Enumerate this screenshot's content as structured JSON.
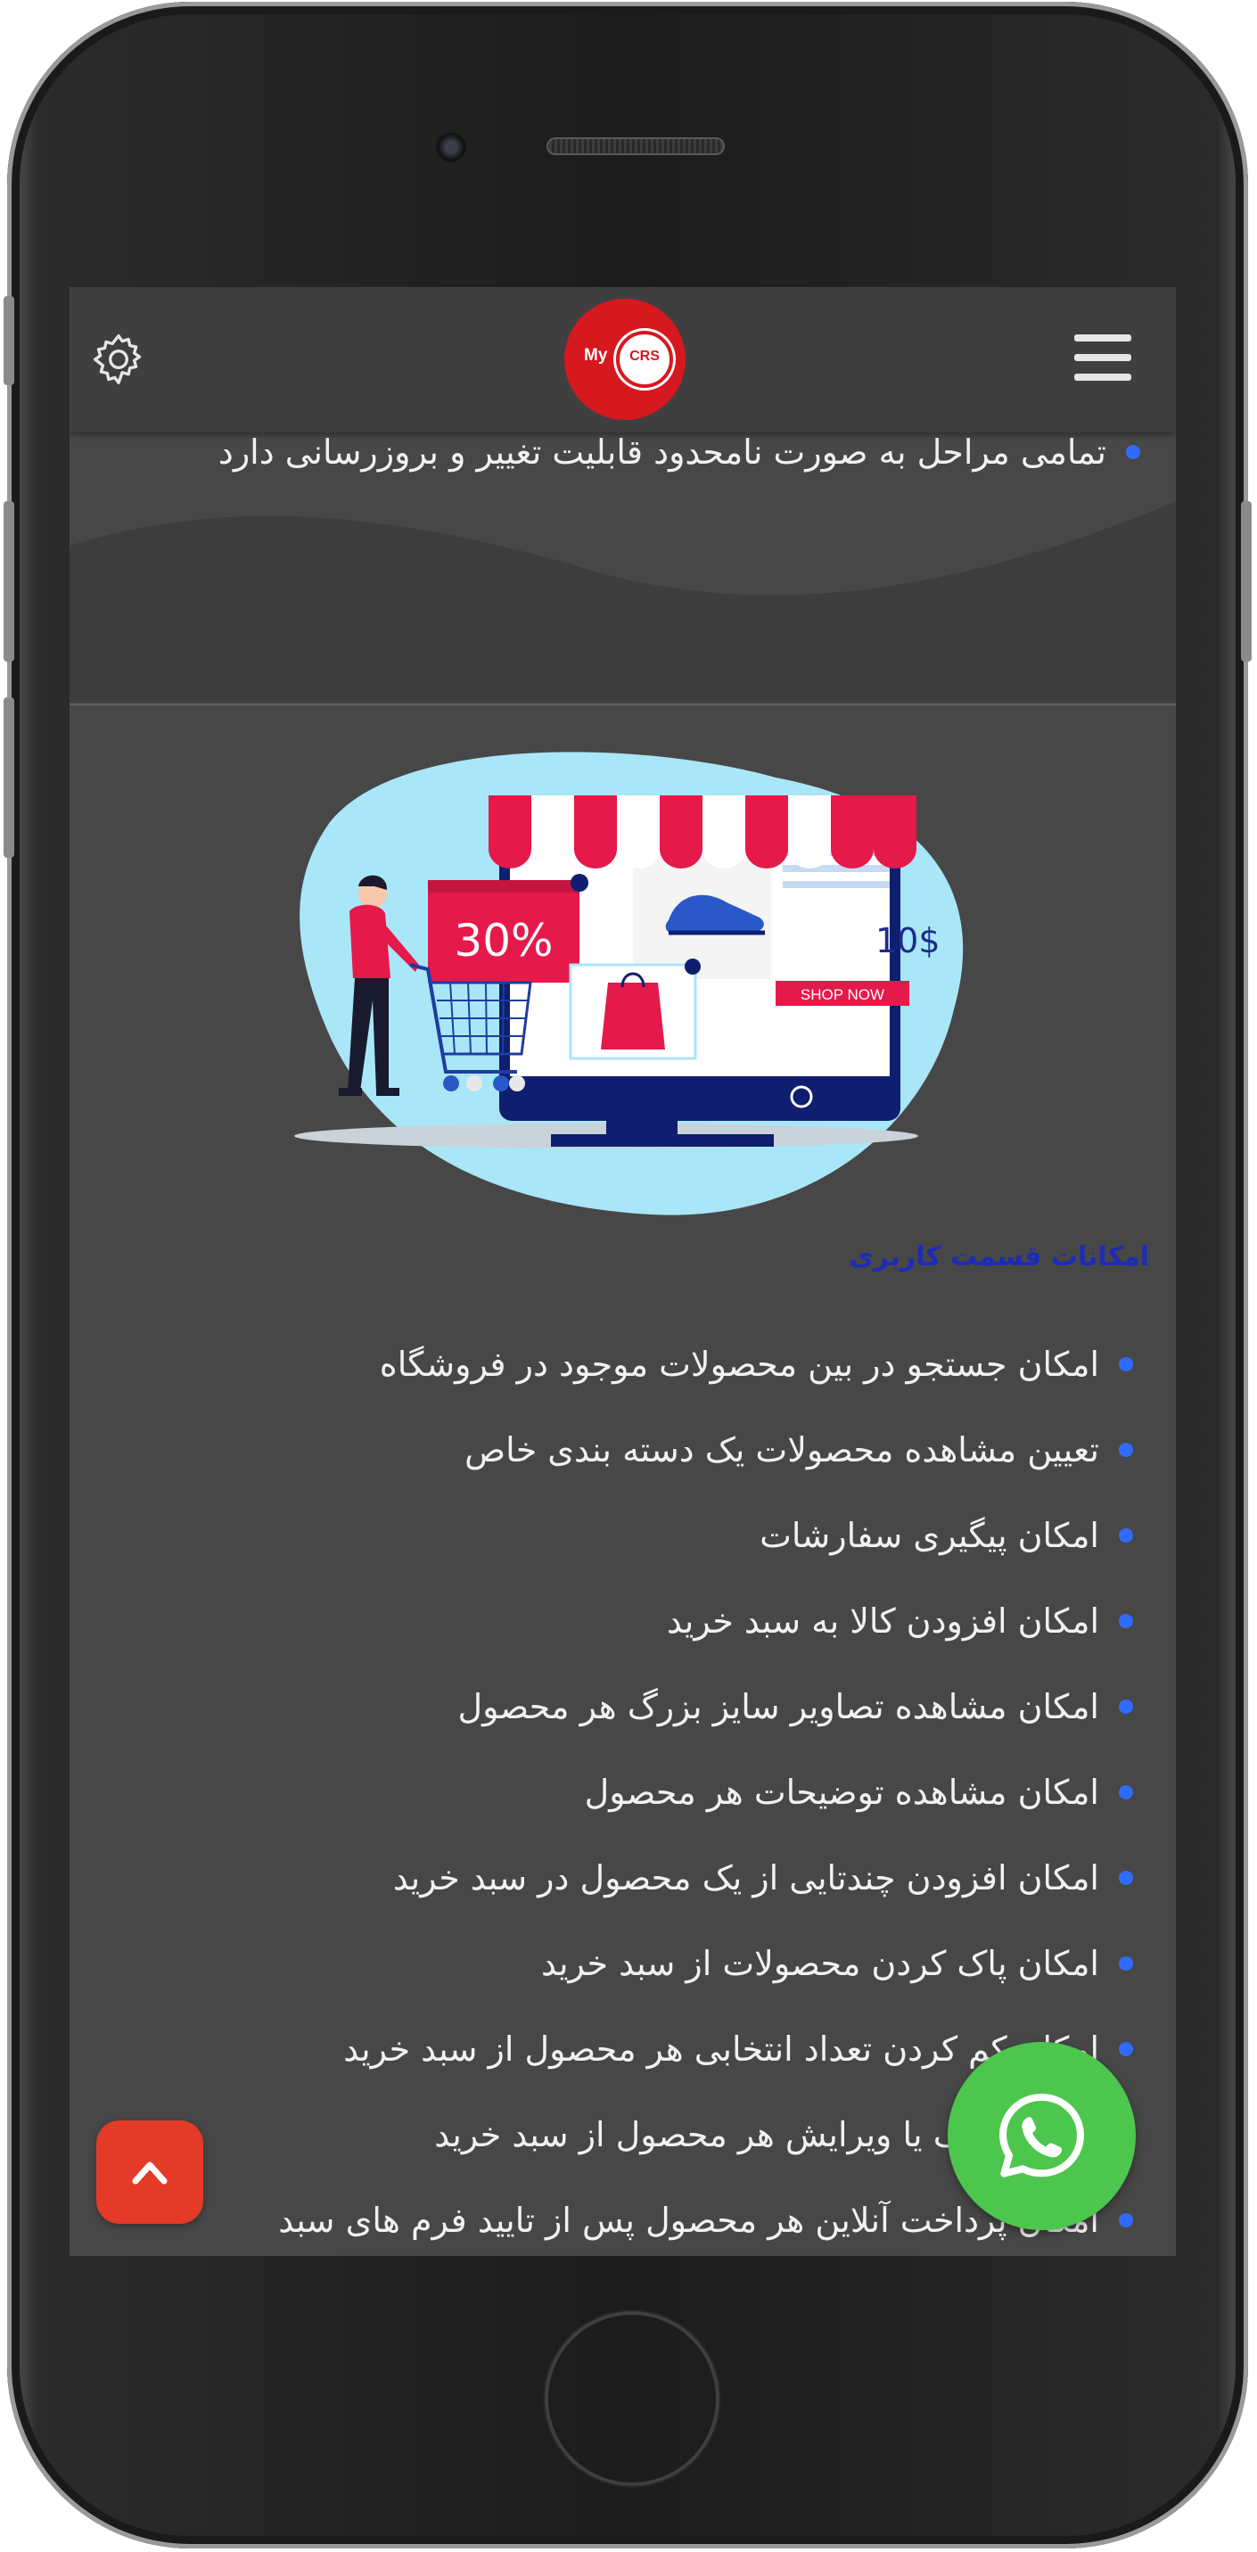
{
  "header": {
    "logo_my": "My",
    "logo_crs": "CRS",
    "settings_icon": "gear-icon",
    "menu_icon": "hamburger-icon"
  },
  "intro": {
    "last_bullet": "تمامی مراحل به صورت نامحدود قابلیت تغییر و بروزرسانی دارد"
  },
  "illustration": {
    "discount": "30%",
    "price": "10$",
    "cta": "SHOP NOW"
  },
  "features": {
    "title": "امکانات قسمت کاربری",
    "items": [
      "امکان جستجو در بین محصولات موجود در فروشگاه",
      "تعیین مشاهده محصولات یک دسته بندی خاص",
      "امکان پیگیری سفارشات",
      "امکان افزودن کالا به سبد خرید",
      "امکان مشاهده تصاویر سایز بزرگ هر محصول",
      "امکان مشاهده توضیحات هر محصول",
      "امکان افزودن چندتایی از یک محصول در سبد خرید",
      "امکان پاک کردن محصولات از سبد خرید",
      "امکان کم کردن تعداد انتخابی هر محصول از سبد خرید",
      "امکان حذف یا ویرایش هر محصول از سبد خرید",
      "امکان پرداخت آنلاین هر محصول پس از تایید فرم های سبد"
    ]
  },
  "floating": {
    "whatsapp_icon": "whatsapp-icon",
    "scroll_top_icon": "chevron-up-icon"
  },
  "colors": {
    "screen_bg": "#474747",
    "header_bg": "#3f3f3f",
    "bullet": "#2f6bff",
    "title": "#1d2bb7",
    "whatsapp": "#4cc64d",
    "scroll_top": "#e33b27",
    "logo_red": "#d6181f"
  }
}
